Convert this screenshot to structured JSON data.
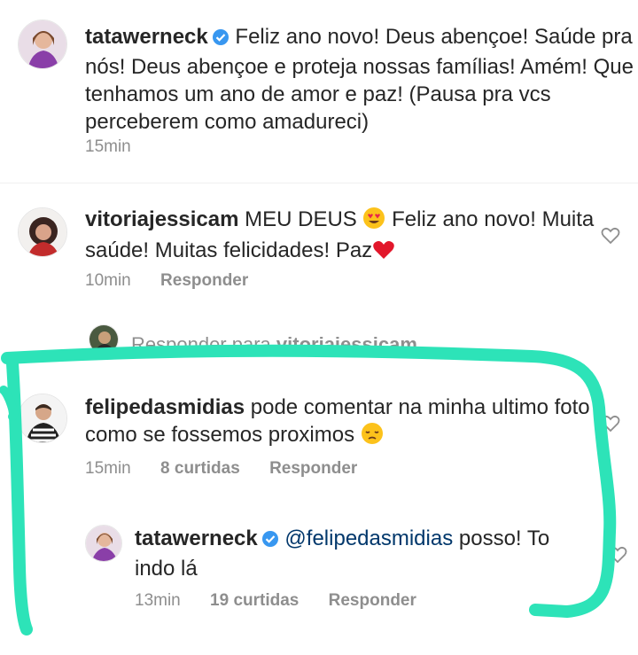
{
  "comments": [
    {
      "username": "tatawerneck",
      "text": "Feliz ano novo! Deus abençoe! Saúde pra nós! Deus abençoe e proteja nossas famílias! Amém! Que tenhamos um ano de amor e paz! (Pausa pra vcs perceberem como amadureci)",
      "time": "15min"
    },
    {
      "username": "vitoriajessicam",
      "text_before": "MEU DEUS",
      "text_after": "Feliz ano novo! Muita saúde! Muitas felicidades! Paz",
      "time": "10min",
      "reply_label": "Responder"
    },
    {
      "username": "felipedasmidias",
      "text": "pode comentar na minha ultimo foto  como se fossemos proximos",
      "time": "15min",
      "likes": "8 curtidas",
      "reply_label": "Responder"
    },
    {
      "username": "tatawerneck",
      "mention": "@felipedasmidias",
      "text": "posso! To indo lá",
      "time": "13min",
      "likes": "19 curtidas",
      "reply_label": "Responder"
    }
  ],
  "reply_prompt": {
    "label": "Responder para",
    "username": "vitoriajessicam..."
  },
  "colors": {
    "highlight_stroke": "#2de3b8",
    "verified": "#3897f0",
    "mention": "#00376b",
    "meta_gray": "#8e8e8e"
  },
  "icons": [
    "verified-badge-icon",
    "heart-icon",
    "heart-eyes-emoji",
    "red-heart-emoji",
    "pensive-emoji"
  ]
}
